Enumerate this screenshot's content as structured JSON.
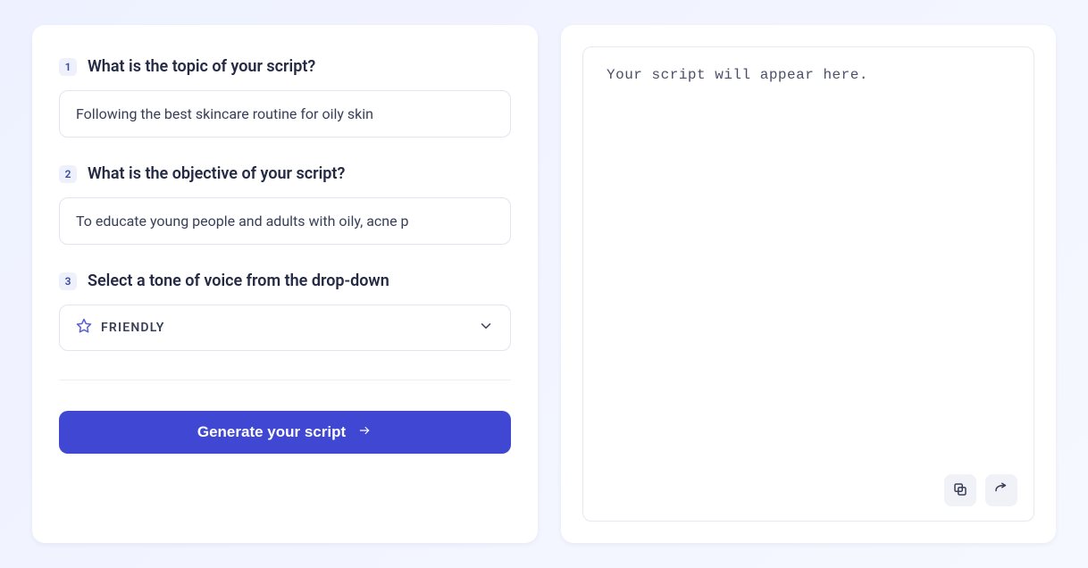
{
  "form": {
    "steps": [
      {
        "num": "1",
        "label": "What is the topic of your script?",
        "value": "Following the best skincare routine for oily skin"
      },
      {
        "num": "2",
        "label": "What is the objective of your script?",
        "value": "To educate young people and adults with oily, acne p"
      },
      {
        "num": "3",
        "label": "Select a tone of voice from the drop-down",
        "selected": "FRIENDLY"
      }
    ],
    "generate_label": "Generate your script"
  },
  "output": {
    "placeholder": "Your script will appear here."
  }
}
